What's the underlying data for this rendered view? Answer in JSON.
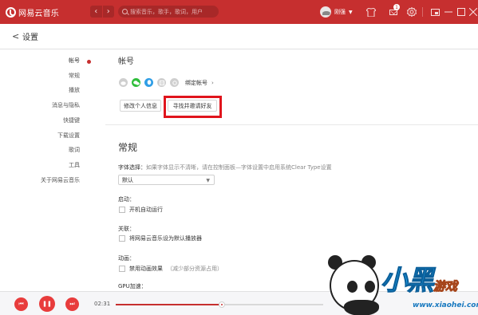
{
  "app": {
    "name": "网易云音乐",
    "colors": {
      "accent": "#c62f2f",
      "highlight_box": "#e0141c"
    }
  },
  "topbar": {
    "back_glyph": "‹",
    "forward_glyph": "›",
    "search_placeholder": "搜索音乐，歌手，歌词，用户",
    "username": "刚强",
    "user_caret": "▼",
    "message_count": "1",
    "icons": [
      "skin-icon",
      "mail-icon",
      "gear-icon",
      "mini-mode-icon",
      "minimize-icon",
      "maximize-icon",
      "close-icon"
    ]
  },
  "page": {
    "back_glyph": "<",
    "title": "设置"
  },
  "sidebar": {
    "items": [
      {
        "label": "帐号",
        "active": true
      },
      {
        "label": "常规"
      },
      {
        "label": "播放"
      },
      {
        "label": "消息与隐私"
      },
      {
        "label": "快捷键"
      },
      {
        "label": "下载设置"
      },
      {
        "label": "歌词"
      },
      {
        "label": "工具"
      },
      {
        "label": "关于网易云音乐"
      }
    ]
  },
  "account": {
    "title": "帐号",
    "social_icons": [
      "weibo-icon",
      "wechat-icon",
      "qq-icon",
      "douban-icon",
      "netease-icon"
    ],
    "bind_label": "绑定帐号",
    "bind_chevron": "›",
    "edit_profile_label": "修改个人信息",
    "invite_friends_label": "寻找并邀请好友"
  },
  "general": {
    "title": "常规",
    "font_label": "字体选择：",
    "font_hint": "如果字体显示不清晰，请在控制面板—字体设置中启用系统Clear Type设置",
    "font_value": "默认",
    "select_arrow": "▼",
    "startup_label": "启动：",
    "autostart_label": "开机自动运行",
    "assoc_label": "关联：",
    "default_player_label": "将网易云音乐设为默认播放器",
    "animation_label": "动画：",
    "disable_animation_label": "禁用动画效果",
    "disable_animation_hint": "（减少部分资源占用）",
    "gpu_label": "GPU加速："
  },
  "player": {
    "prev_glyph": "⏮",
    "play_glyph": "❚❚",
    "next_glyph": "⏭",
    "elapsed": "02:31",
    "progress": 0.51
  },
  "watermark": {
    "brand": "小黑",
    "game": "游戏",
    "url": "www.xiaohei.com"
  }
}
